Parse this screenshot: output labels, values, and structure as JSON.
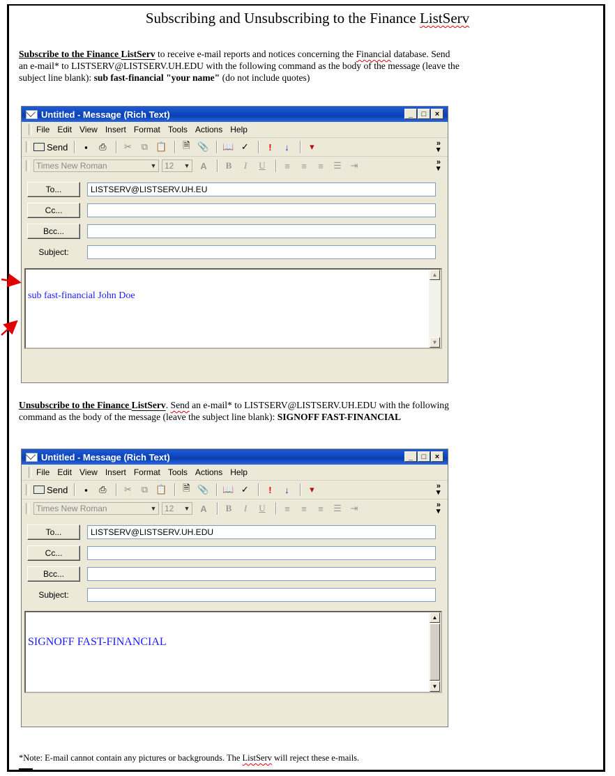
{
  "doc": {
    "title_pre": "Subscribing and Unsubscribing to the Finance ",
    "title_word": "ListServ",
    "sub_heading_a": "Subscribe to the Finance ",
    "sub_heading_b": "ListServ",
    "sub_text_1": " to receive e-mail reports and notices concerning the ",
    "sub_text_fin": "Financial",
    "sub_text_2": " database.  Send",
    "sub_line2": "an e-mail* to LISTSERV@LISTSERV.UH.EDU with the following command as the body of the message (leave the",
    "sub_line3_a": "subject line blank):  ",
    "sub_line3_cmd": "sub fast-financial \"your name\"",
    "sub_line3_b": " (do not include quotes)",
    "unsub_heading_a": "Unsubscribe to the Finance ",
    "unsub_heading_b": "ListServ",
    "unsub_text_1": ".  ",
    "unsub_send": "Send",
    "unsub_text_2": " an e-mail* to LISTSERV@LISTSERV.UH.EDU with the following",
    "unsub_line2_a": "command as the body of the message (leave the subject line blank):  ",
    "unsub_line2_cmd": "SIGNOFF FAST-FINANCIAL",
    "note_a": "*Note:  E-mail cannot contain any pictures or backgrounds.  The ",
    "note_word": "ListServ",
    "note_b": " will reject these e-mails."
  },
  "window1": {
    "title": "Untitled - Message (Rich Text)",
    "menu": [
      "File",
      "Edit",
      "View",
      "Insert",
      "Format",
      "Tools",
      "Actions",
      "Help"
    ],
    "send_label": "Send",
    "font_name": "Times New Roman",
    "font_size": "12",
    "to_label": "To...",
    "cc_label": "Cc...",
    "bcc_label": "Bcc...",
    "subject_label": "Subject:",
    "to_value": "LISTSERV@LISTSERV.UH.EU",
    "cc_value": "",
    "bcc_value": "",
    "subject_value": "",
    "body_text": "sub fast-financial John Doe"
  },
  "window2": {
    "title": "Untitled - Message (Rich Text)",
    "menu": [
      "File",
      "Edit",
      "View",
      "Insert",
      "Format",
      "Tools",
      "Actions",
      "Help"
    ],
    "send_label": "Send",
    "font_name": "Times New Roman",
    "font_size": "12",
    "to_label": "To...",
    "cc_label": "Cc...",
    "bcc_label": "Bcc...",
    "subject_label": "Subject:",
    "to_value": "LISTSERV@LISTSERV.UH.EDU",
    "cc_value": "",
    "bcc_value": "",
    "subject_value": "",
    "body_text": "SIGNOFF FAST-FINANCIAL"
  },
  "colors": {
    "annotation_arrow": "#e00000",
    "body_text": "#1a1aff",
    "titlebar": "#0a3fb2"
  }
}
